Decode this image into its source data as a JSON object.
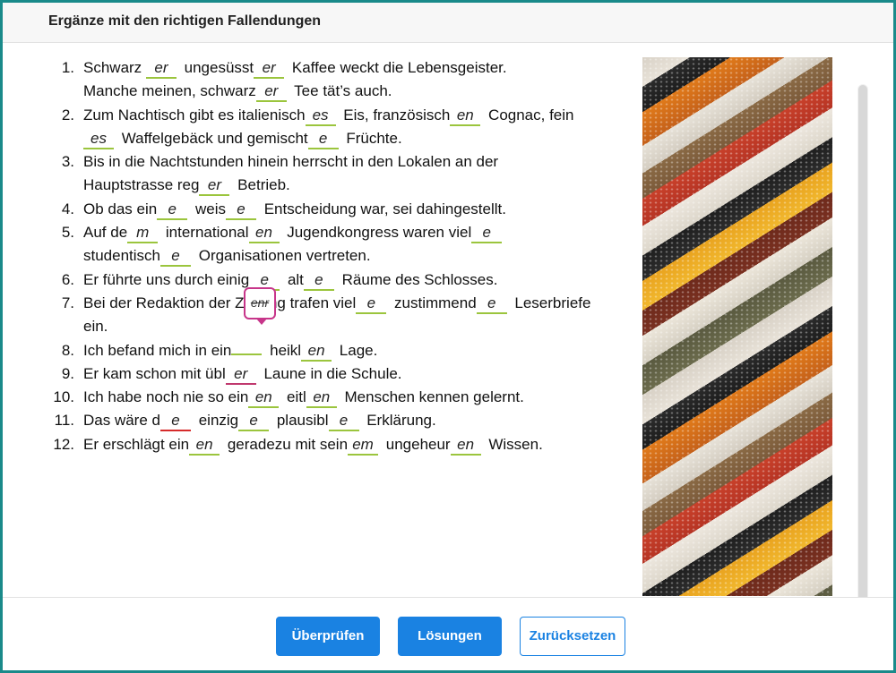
{
  "header": {
    "title": "Ergänze mit den richtigen Fallendungen"
  },
  "items": [
    {
      "num": "1.",
      "lines": [
        [
          {
            "t": "Schwarz "
          },
          {
            "g": "er"
          },
          {
            "t": " ungesüsst"
          },
          {
            "g": "er"
          },
          {
            "t": " Kaffee weckt die Lebensgeister."
          }
        ],
        [
          {
            "t": "Manche meinen, schwarz"
          },
          {
            "g": "er"
          },
          {
            "t": " Tee tät’s auch."
          }
        ]
      ]
    },
    {
      "num": "2.",
      "lines": [
        [
          {
            "t": "Zum Nachtisch gibt es italienisch"
          },
          {
            "g": "es"
          },
          {
            "t": " Eis, französisch"
          },
          {
            "g": "en"
          },
          {
            "t": " Cognac, fein"
          }
        ],
        [
          {
            "g": "es"
          },
          {
            "t": " Waffelgebäck und gemischt"
          },
          {
            "g": "e"
          },
          {
            "t": " Früchte."
          }
        ]
      ]
    },
    {
      "num": "3.",
      "lines": [
        [
          {
            "t": "Bis in die Nachtstunden hinein herrscht in den Lokalen an der"
          }
        ],
        [
          {
            "t": "Hauptstrasse reg"
          },
          {
            "g": "er"
          },
          {
            "t": " Betrieb."
          }
        ]
      ]
    },
    {
      "num": "4.",
      "lines": [
        [
          {
            "t": "Ob das ein"
          },
          {
            "g": "e"
          },
          {
            "t": " weis"
          },
          {
            "g": "e"
          },
          {
            "t": " Entscheidung war, sei dahingestellt."
          }
        ]
      ]
    },
    {
      "num": "5.",
      "lines": [
        [
          {
            "t": "Auf de"
          },
          {
            "g": "m"
          },
          {
            "t": " international"
          },
          {
            "g": "en"
          },
          {
            "t": " Jugendkongress waren viel"
          },
          {
            "g": "e"
          }
        ],
        [
          {
            "t": "studentisch"
          },
          {
            "g": "e"
          },
          {
            "t": " Organisationen vertreten."
          }
        ]
      ]
    },
    {
      "num": "6.",
      "lines": [
        [
          {
            "t": "Er führte uns durch einig"
          },
          {
            "g": "e"
          },
          {
            "t": " alt"
          },
          {
            "g": "e"
          },
          {
            "t": " Räume des Schlosses."
          }
        ]
      ]
    },
    {
      "num": "7.",
      "lines": [
        [
          {
            "t": "Bei der Redaktion der Zeitung trafen viel"
          },
          {
            "g": "e"
          },
          {
            "t": " zustimmend"
          },
          {
            "g": "e"
          },
          {
            "t": " Leserbriefe"
          }
        ],
        [
          {
            "t": "ein."
          }
        ]
      ]
    },
    {
      "num": "8.",
      "lines": [
        [
          {
            "t": "Ich befand mich in ein"
          },
          {
            "g": ""
          },
          {
            "t": " heikl"
          },
          {
            "g": "en"
          },
          {
            "t": " Lage."
          }
        ]
      ]
    },
    {
      "num": "9.",
      "lines": [
        [
          {
            "t": "Er kam schon mit übl"
          },
          {
            "g": "er",
            "s": "focus"
          },
          {
            "t": " Laune in die Schule."
          }
        ]
      ]
    },
    {
      "num": "10.",
      "lines": [
        [
          {
            "t": "Ich habe noch nie so ein"
          },
          {
            "g": "en"
          },
          {
            "t": " eitl"
          },
          {
            "g": "en"
          },
          {
            "t": " Menschen kennen gelernt."
          }
        ]
      ]
    },
    {
      "num": "11.",
      "lines": [
        [
          {
            "t": "Das wäre d"
          },
          {
            "g": "e",
            "s": "wrong"
          },
          {
            "t": " einzig"
          },
          {
            "g": "e"
          },
          {
            "t": " plausibl"
          },
          {
            "g": "e"
          },
          {
            "t": " Erklärung."
          }
        ]
      ]
    },
    {
      "num": "12.",
      "lines": [
        [
          {
            "t": "Er erschlägt ein"
          },
          {
            "g": "en"
          },
          {
            "t": " geradezu mit sein"
          },
          {
            "g": "em"
          },
          {
            "t": " ungeheur"
          },
          {
            "g": "en"
          },
          {
            "t": " Wissen."
          }
        ]
      ]
    }
  ],
  "tooltip": {
    "text": "enr"
  },
  "buttons": {
    "check": "Überprüfen",
    "solutions": "Lösungen",
    "reset": "Zurücksetzen"
  }
}
